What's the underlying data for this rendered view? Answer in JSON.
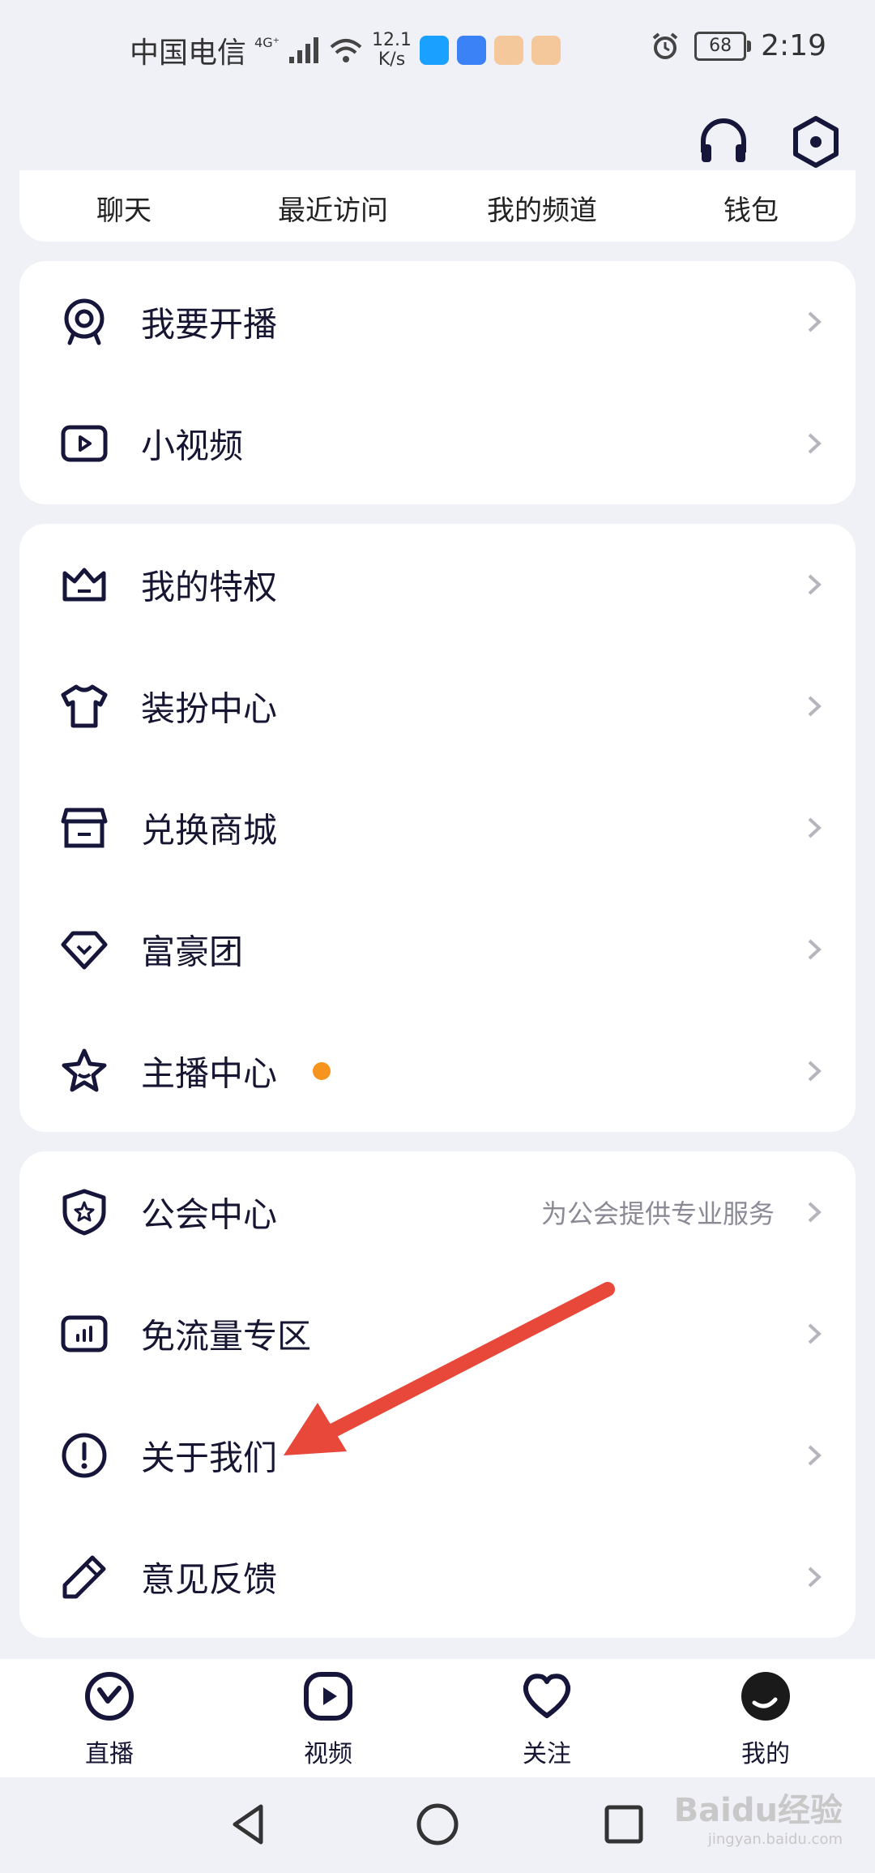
{
  "status_bar": {
    "carrier": "中国电信",
    "network": "4G⁺",
    "speed_value": "12.1",
    "speed_unit": "K/s",
    "battery": "68",
    "time": "2:19"
  },
  "header": {
    "icons": [
      "headphones-icon",
      "settings-hexagon-icon"
    ]
  },
  "shortcuts": [
    "聊天",
    "最近访问",
    "我的频道",
    "钱包"
  ],
  "card1": [
    {
      "label": "我要开播",
      "icon": "webcam-icon"
    },
    {
      "label": "小视频",
      "icon": "video-play-icon"
    }
  ],
  "card2": [
    {
      "label": "我的特权",
      "icon": "crown-icon"
    },
    {
      "label": "装扮中心",
      "icon": "tshirt-icon"
    },
    {
      "label": "兑换商城",
      "icon": "store-icon"
    },
    {
      "label": "富豪团",
      "icon": "diamond-icon"
    },
    {
      "label": "主播中心",
      "icon": "star-icon",
      "badge_color": "#f7941d"
    }
  ],
  "card3": [
    {
      "label": "公会中心",
      "icon": "shield-star-icon",
      "subtitle": "为公会提供专业服务"
    },
    {
      "label": "免流量专区",
      "icon": "bar-chart-icon"
    },
    {
      "label": "关于我们",
      "icon": "info-circle-icon"
    },
    {
      "label": "意见反馈",
      "icon": "pencil-icon"
    }
  ],
  "annotation": {
    "color": "#e8483a"
  },
  "bottom_nav": [
    {
      "label": "直播",
      "icon": "live-icon"
    },
    {
      "label": "视频",
      "icon": "video-tab-icon"
    },
    {
      "label": "关注",
      "icon": "heart-icon"
    },
    {
      "label": "我的",
      "icon": "avatar-icon"
    }
  ],
  "system_nav": [
    "back-icon",
    "home-icon",
    "recents-icon"
  ],
  "watermark": {
    "text": "Baidu经验",
    "sub": "jingyan.baidu.com"
  }
}
